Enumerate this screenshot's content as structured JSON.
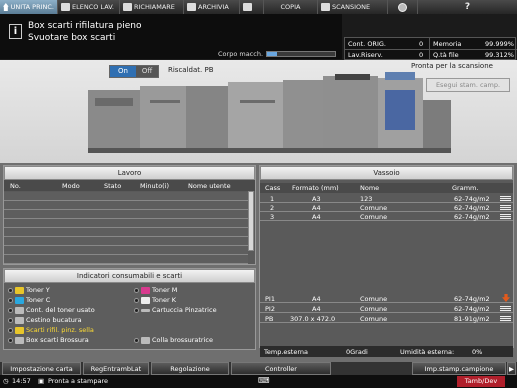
{
  "tabs": [
    {
      "label": "UNITA PRINC.",
      "icon": "home-icon",
      "active": true
    },
    {
      "label": "ELENCO LAV.",
      "icon": "job-list-icon",
      "active": false
    },
    {
      "label": "RICHIAMARE",
      "icon": "recall-icon",
      "active": false
    },
    {
      "label": "ARCHIVIA",
      "icon": "archive-icon",
      "active": false
    },
    {
      "label": "",
      "icon": "address-book-icon",
      "active": false
    },
    {
      "label": "COPIA",
      "icon": "copy-icon",
      "active": false
    },
    {
      "label": "SCANSIONE",
      "icon": "scan-icon",
      "active": false
    },
    {
      "label": "",
      "icon": "globe-icon",
      "active": false
    },
    {
      "label": "?",
      "icon": "help-icon",
      "active": false
    }
  ],
  "message": {
    "line1": "Box scarti rifilatura pieno",
    "line2": "Svuotare box scarti",
    "icon": "info-icon",
    "corpo_label": "Corpo macch.",
    "corpo_level": 0.15
  },
  "counters": {
    "orig_label": "Cont. ORIG.",
    "orig_value": "0",
    "memoria_label": "Memoria",
    "memoria_value": "99.999%",
    "riserv_label": "Lav.Riserv.",
    "riserv_value": "0",
    "file_label": "Q.tà file",
    "file_value": "99.312%"
  },
  "machine": {
    "on_label": "On",
    "off_label": "Off",
    "preheat_label": "Riscaldat. PB",
    "status_text": "Pronta per la scansione",
    "sample_button": "Esegui stam. camp."
  },
  "lavoro": {
    "title": "Lavoro",
    "columns": [
      "No.",
      "Modo",
      "Stato",
      "Minuto(i)",
      "Nome utente"
    ],
    "rows": []
  },
  "consumabili": {
    "title": "Indicatori consumabili e scarti",
    "items": [
      {
        "label": "Toner Y",
        "symbol": "toner-yellow-icon",
        "color": "#e8c62a"
      },
      {
        "label": "Toner M",
        "symbol": "toner-magenta-icon",
        "color": "#d83a8e"
      },
      {
        "label": "Toner C",
        "symbol": "toner-cyan-icon",
        "color": "#2aa8df"
      },
      {
        "label": "Toner K",
        "symbol": "toner-black-icon",
        "color": "#eeeeee"
      },
      {
        "label": "Cont. del toner usato",
        "symbol": "waste-toner-icon",
        "color": "#cccccc"
      },
      {
        "label": "Cartuccia Pinzatrice",
        "symbol": "staple-cartridge-icon",
        "color": "#cccccc"
      },
      {
        "label": "Cestino bucatura",
        "symbol": "punch-bin-icon",
        "color": "#cccccc"
      },
      {
        "label": "Scarti rifil. pinz. sella",
        "symbol": "trim-waste-icon",
        "color": "#e8c62a",
        "highlight": true
      },
      {
        "label": "Box scarti Brossura",
        "symbol": "binding-waste-icon",
        "color": "#cccccc"
      },
      {
        "label": "Colla brossuratrice",
        "symbol": "glue-icon",
        "color": "#cccccc"
      }
    ]
  },
  "vassoio": {
    "title": "Vassoio",
    "columns": [
      "Cass",
      "Formato (mm)",
      "Nome",
      "Gramm."
    ],
    "rows": [
      {
        "cass": "1",
        "formato": "A3",
        "nome": "123",
        "gramm": "62-74g/m2",
        "level": 0.8
      },
      {
        "cass": "2",
        "formato": "A4",
        "nome": "Comune",
        "gramm": "62-74g/m2",
        "level": 0.8
      },
      {
        "cass": "3",
        "formato": "A4",
        "nome": "Comune",
        "gramm": "62-74g/m2",
        "level": 0.8
      },
      {
        "cass": "PI1",
        "formato": "A4",
        "nome": "Comune",
        "gramm": "62-74g/m2",
        "level": 0.1
      },
      {
        "cass": "PI2",
        "formato": "A4",
        "nome": "Comune",
        "gramm": "62-74g/m2",
        "level": 0.8
      },
      {
        "cass": "PB",
        "formato": "307.0 x 472.0",
        "nome": "Comune",
        "gramm": "81-91g/m2",
        "level": 0.8
      }
    ],
    "temp_label": "Temp.esterna",
    "temp_value": "0Gradi",
    "hum_label": "Umidità esterna:",
    "hum_value": "0%"
  },
  "buttons": {
    "impostazione": "Impostazione carta",
    "regentrambi": "RegEntrambLat",
    "regolazione": "Regolazione",
    "controller": "Controller",
    "stamp_campione": "Imp.stamp.campione"
  },
  "status": {
    "time": "14:57",
    "ready": "Pronta a stampare",
    "tandem": "Tamb/Dev"
  }
}
